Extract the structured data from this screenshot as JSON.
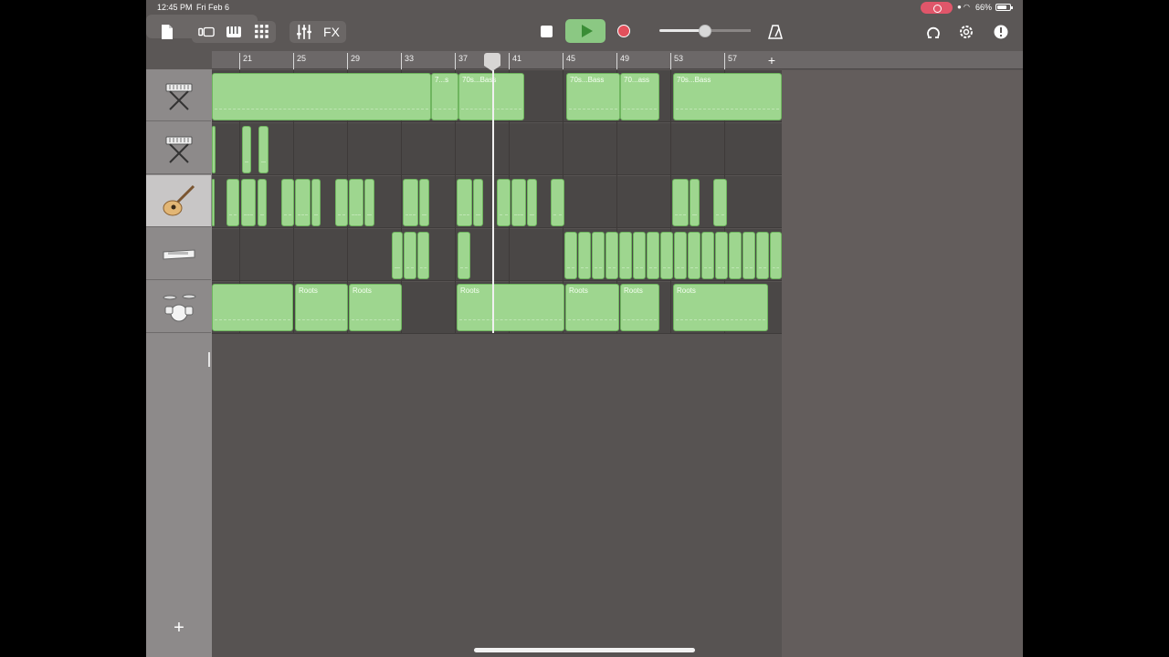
{
  "status_bar": {
    "time": "12:45 PM",
    "date": "Fri Feb 6",
    "battery": "66%"
  },
  "toolbar": {
    "fx_label": "FX",
    "icons": [
      "document-icon",
      "browser-icon",
      "keys-icon",
      "grid-icon",
      "mixer-icon",
      "metronome-icon",
      "loop-icon",
      "settings-icon",
      "help-icon"
    ]
  },
  "ruler": {
    "bars": [
      "21",
      "25",
      "29",
      "33",
      "37",
      "41",
      "45",
      "49",
      "53",
      "57"
    ],
    "add_label": "+"
  },
  "tracks": [
    {
      "name": "keyboard",
      "icon": "keyboard-stand-icon",
      "selected": false
    },
    {
      "name": "keyboard-2",
      "icon": "keyboard-stand-icon",
      "selected": false
    },
    {
      "name": "acoustic-guitar",
      "icon": "acoustic-guitar-icon",
      "selected": true
    },
    {
      "name": "synth",
      "icon": "synth-icon",
      "selected": false
    },
    {
      "name": "drums",
      "icon": "drum-kit-icon",
      "selected": false
    }
  ],
  "regions": {
    "lane0": [
      "",
      "7...s",
      "70s...Bass",
      "70s...Bass",
      "70...ass",
      "70s...Bass"
    ],
    "lane4": [
      "",
      "Roots",
      "Roots",
      "Roots",
      "Roots",
      "Roots",
      "Roots"
    ]
  },
  "add_track_label": "+",
  "colors": {
    "region_green": "#9ed68f",
    "play_green": "#8bc883",
    "record_red": "#e3505c",
    "background": "#5b5756"
  }
}
